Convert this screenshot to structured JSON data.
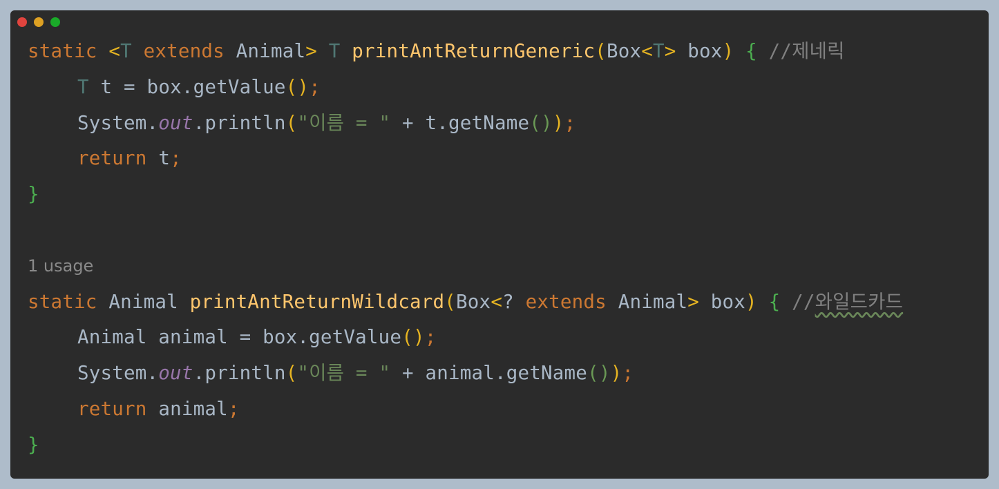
{
  "window": {
    "controls": [
      {
        "name": "close-dot",
        "color": "#e0443e"
      },
      {
        "name": "minimize-dot",
        "color": "#dea123"
      },
      {
        "name": "zoom-dot",
        "color": "#1aab29"
      }
    ]
  },
  "colors": {
    "background": "#aebcca",
    "editor": "#2b2b2b",
    "keyword": "#cc7832",
    "function": "#ffc66d",
    "type_param": "#507874",
    "text": "#a9b7c6",
    "string": "#6a8759",
    "field": "#9876aa",
    "comment": "#808080"
  },
  "code": {
    "generic": {
      "l1": {
        "static": "static",
        "lt": "<",
        "T1": "T",
        "extends": "extends",
        "animal": "Animal",
        "gt": ">",
        "T2": "T",
        "fn": "printAntReturnGeneric",
        "lparen": "(",
        "box_type": "Box",
        "lt2": "<",
        "T3": "T",
        "gt2": ">",
        "param": "box",
        "rparen": ")",
        "lbrace": "{",
        "comment": "//제네릭"
      },
      "l2": {
        "T": "T",
        "rest": "t = box.getValue",
        "parens": "()",
        "semi": ";"
      },
      "l3": {
        "system": "System.",
        "out": "out",
        "println": ".println",
        "lparen": "(",
        "str": "\"이름 = \"",
        "concat": " + t.getName",
        "inner": "()",
        "rparen": ")",
        "semi": ";"
      },
      "l4": {
        "ret": "return",
        "val": "t",
        "semi": ";"
      },
      "l5": {
        "rbrace": "}"
      }
    },
    "usage_hint": "1 usage",
    "wildcard": {
      "l1": {
        "static": "static",
        "animal": "Animal",
        "fn": "printAntReturnWildcard",
        "lparen": "(",
        "box_type": "Box",
        "lt": "<",
        "q": "?",
        "extends": "extends",
        "animal2": "Animal",
        "gt": ">",
        "param": "box",
        "rparen": ")",
        "lbrace": "{",
        "comment_prefix": "//",
        "comment_word": "와일드카드"
      },
      "l2": {
        "decl": "Animal animal = box.getValue",
        "parens": "()",
        "semi": ";"
      },
      "l3": {
        "system": "System.",
        "out": "out",
        "println": ".println",
        "lparen": "(",
        "str": "\"이름 = \"",
        "concat": " + animal.getName",
        "inner": "()",
        "rparen": ")",
        "semi": ";"
      },
      "l4": {
        "ret": "return",
        "val": "animal",
        "semi": ";"
      },
      "l5": {
        "rbrace": "}"
      }
    }
  }
}
